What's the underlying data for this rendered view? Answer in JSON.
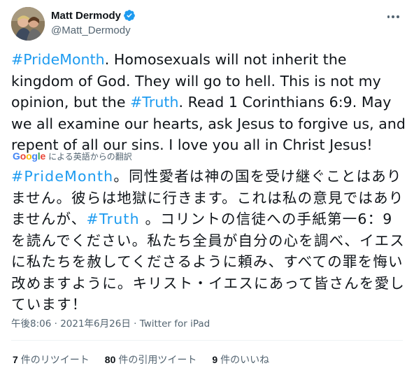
{
  "author": {
    "display_name": "Matt Dermody",
    "handle": "@Matt_Dermody",
    "verified": true
  },
  "tweet": {
    "hashtag1": "#PrideMonth",
    "seg1": ". Homosexuals will not inherit the kingdom of God. They will go to hell. This is not my opinion, but the ",
    "hashtag2": "#Truth",
    "seg2": ". Read 1 Corinthians 6:9. May we all examine our hearts, ask Jesus to forgive us, and repent of all our sins. I love you all in Christ Jesus!"
  },
  "translation": {
    "provider": "Google",
    "label": "による英語からの翻訳",
    "hashtag1": "#PrideMonth",
    "seg1": "。同性愛者は神の国を受け継ぐことはありません。彼らは地獄に行きます。これは私の意見ではありませんが、",
    "hashtag2": "#Truth",
    "seg2": " 。コリントの信徒への手紙第一6：9を読んでください。私たち全員が自分の心を調べ、イエスに私たちを赦してくださるように頼み、すべての罪を悔い改めますように。キリスト・イエスにあって皆さんを愛しています！"
  },
  "meta": {
    "time": "午後8:06",
    "separator1": " · ",
    "date": "2021年6月26日",
    "separator2": " · ",
    "source": "Twitter for iPad"
  },
  "stats": [
    {
      "count": "7",
      "label": "件のリツイート"
    },
    {
      "count": "80",
      "label": "件の引用ツイート"
    },
    {
      "count": "9",
      "label": "件のいいね"
    }
  ],
  "colors": {
    "link": "#1d9bf0",
    "verified": "#1d9bf0",
    "secondary_text": "#536471"
  }
}
